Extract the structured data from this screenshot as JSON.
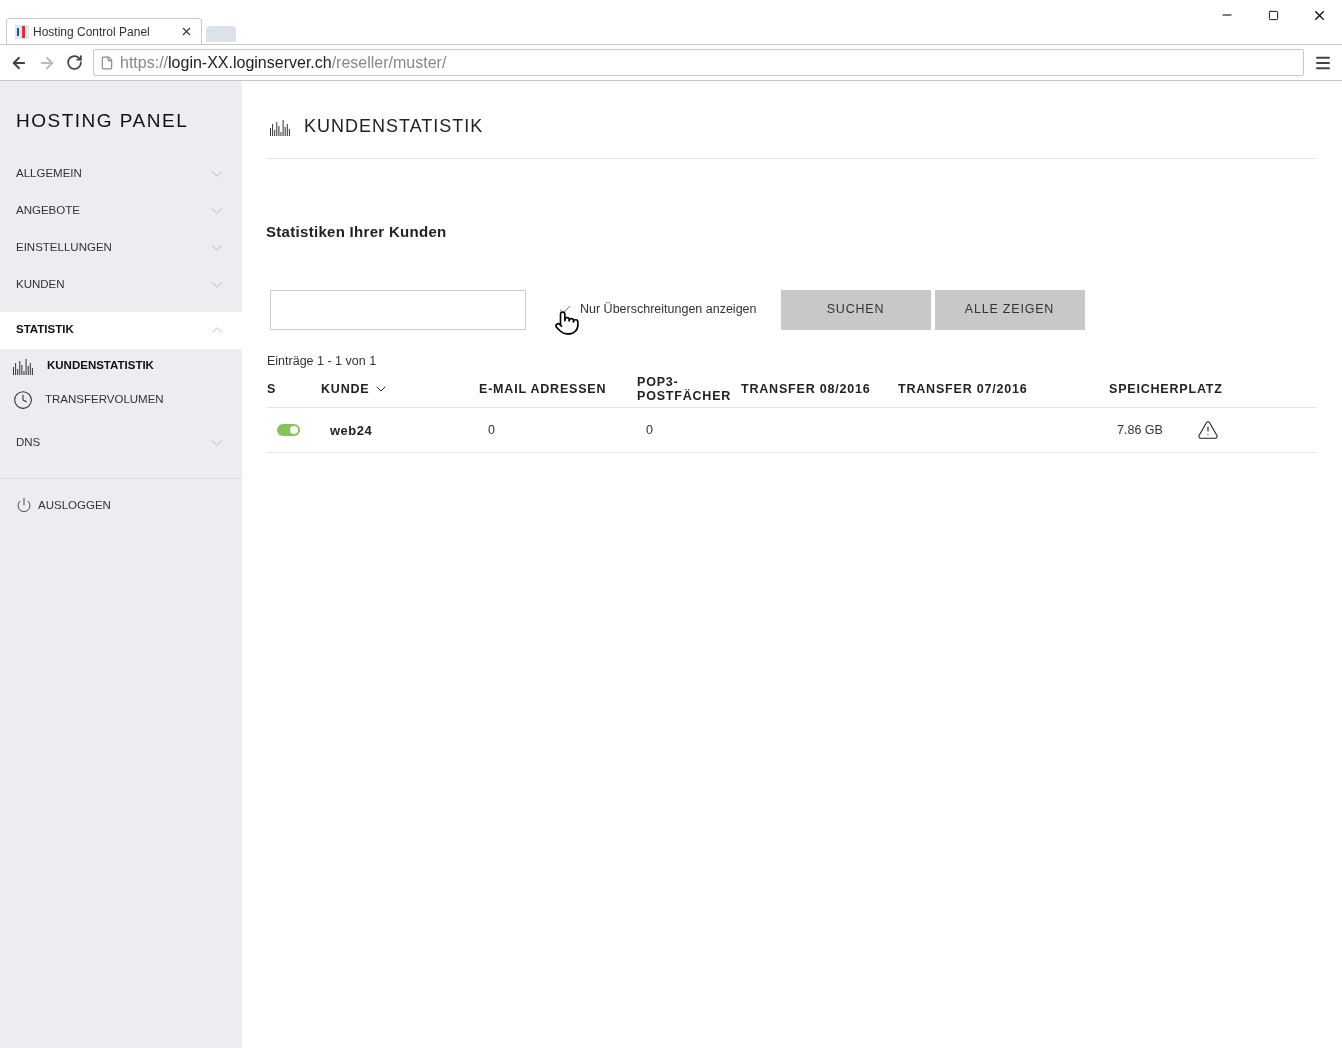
{
  "browser": {
    "tab_title": "Hosting Control Panel",
    "url_scheme": "https://",
    "url_host": "login-XX.loginserver.ch",
    "url_path": "/reseller/muster/"
  },
  "sidebar": {
    "title": "HOSTING PANEL",
    "items": [
      {
        "label": "ALLGEMEIN",
        "expanded": false
      },
      {
        "label": "ANGEBOTE",
        "expanded": false
      },
      {
        "label": "EINSTELLUNGEN",
        "expanded": false
      },
      {
        "label": "KUNDEN",
        "expanded": false
      },
      {
        "label": "STATISTIK",
        "expanded": true,
        "children": [
          {
            "label": "KUNDENSTATISTIK",
            "kind": "chart",
            "selected": true
          },
          {
            "label": "TRANSFERVOLUMEN",
            "kind": "clock",
            "selected": false
          }
        ]
      },
      {
        "label": "DNS",
        "expanded": false
      }
    ],
    "logout": "AUSLOGGEN"
  },
  "page": {
    "title": "KUNDENSTATISTIK",
    "subtitle": "Statistiken Ihrer Kunden",
    "filter": {
      "checked": true,
      "label": "Nur Überschreitungen anzeigen"
    },
    "buttons": [
      "SUCHEN",
      "ALLE ZEIGEN"
    ],
    "entries": "Einträge 1 - 1 von 1",
    "table": {
      "columns": [
        "S",
        "KUNDE",
        "E-MAIL ADRESSEN",
        "POP3-POSTFÄCHER",
        "TRANSFER 08/2016",
        "TRANSFER 07/2016",
        "SPEICHERPLATZ"
      ],
      "rows": [
        {
          "on": true,
          "kunde": "web24",
          "email": "0",
          "pop3": "0",
          "transfer_08": "",
          "transfer_07": "",
          "speicher": "7.86 GB",
          "warning": true
        }
      ]
    }
  }
}
